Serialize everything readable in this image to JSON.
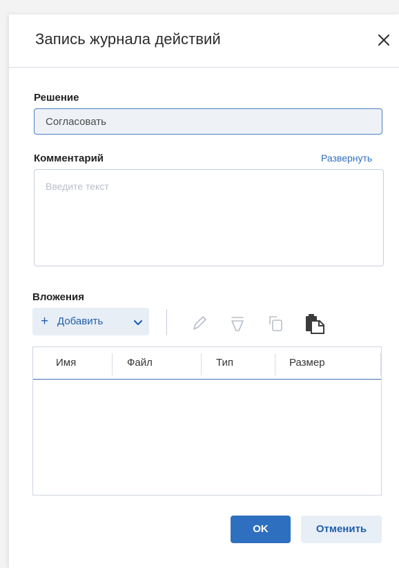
{
  "dialog": {
    "title": "Запись журнала действий",
    "close_icon": "close-icon"
  },
  "decision": {
    "label": "Решение",
    "value": "Согласовать"
  },
  "comment": {
    "label": "Комментарий",
    "expand_link": "Развернуть",
    "placeholder": "Введите текст",
    "value": ""
  },
  "attachments": {
    "label": "Вложения",
    "add_button": {
      "plus": "+",
      "label": "Добавить",
      "icon": "chevron-down-icon"
    },
    "toolbar_icons": [
      "edit-icon",
      "delete-icon",
      "copy-icon",
      "paste-icon"
    ],
    "columns": [
      "Имя",
      "Файл",
      "Тип",
      "Размер"
    ],
    "rows": []
  },
  "footer": {
    "ok_label": "OK",
    "cancel_label": "Отменить"
  },
  "colors": {
    "accent": "#2f6fbf",
    "accent_light": "#e8eef6",
    "border": "#c8cfd8",
    "disabled_icon": "#b7bec8"
  }
}
